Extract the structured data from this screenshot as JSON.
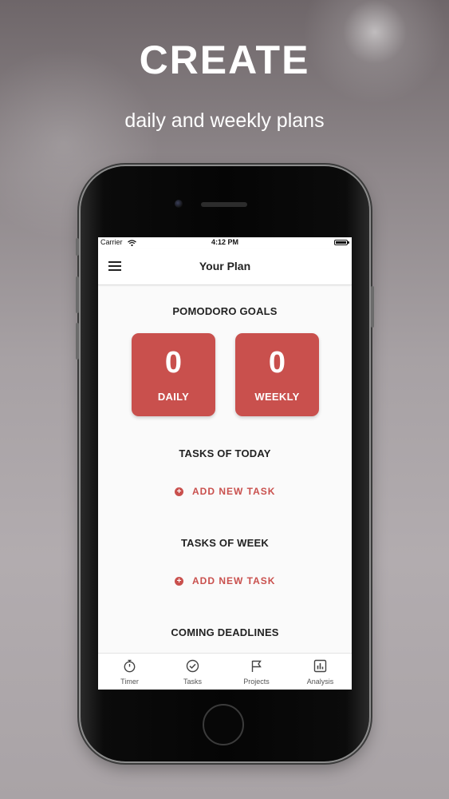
{
  "promo": {
    "headline": "CREATE",
    "subline": "daily and weekly plans"
  },
  "status_bar": {
    "carrier": "Carrier",
    "time": "4:12 PM",
    "icons": [
      "wifi-icon",
      "battery-icon"
    ]
  },
  "navbar": {
    "title": "Your Plan",
    "menu_icon": "hamburger-menu-icon"
  },
  "goals": {
    "title": "POMODORO GOALS",
    "daily": {
      "value": "0",
      "label": "DAILY"
    },
    "weekly": {
      "value": "0",
      "label": "WEEKLY"
    },
    "card_color": "#c9504d"
  },
  "today": {
    "title": "TASKS OF TODAY",
    "add_label": "ADD NEW TASK"
  },
  "week": {
    "title": "TASKS OF WEEK",
    "add_label": "ADD NEW TASK"
  },
  "deadlines": {
    "title": "COMING DEADLINES"
  },
  "tabbar": {
    "items": [
      {
        "label": "Timer",
        "icon": "stopwatch-icon"
      },
      {
        "label": "Tasks",
        "icon": "check-circle-icon"
      },
      {
        "label": "Projects",
        "icon": "flag-icon"
      },
      {
        "label": "Analysis",
        "icon": "bar-chart-icon"
      }
    ]
  }
}
